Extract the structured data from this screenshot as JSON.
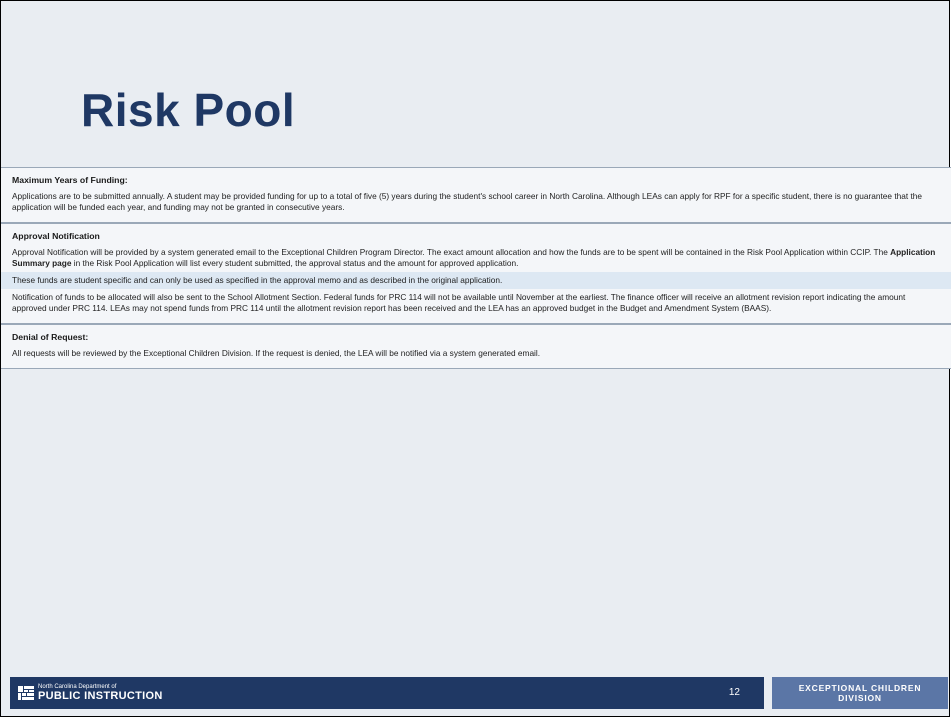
{
  "slide": {
    "title": "Risk Pool",
    "page_number": "12"
  },
  "sections": {
    "max_years_header": "Maximum Years of Funding:",
    "max_years_text": "Applications are to be submitted annually. A student may be provided funding for up to a total of five (5) years during the student's school career in North Carolina. Although LEAs can apply for RPF for a specific student, there is no guarantee that the application will be funded each year, and funding may not be granted in consecutive years.",
    "approval_header": "Approval Notification",
    "approval_text_1": "Approval Notification will be provided by a system generated email to the Exceptional Children Program Director. The exact amount allocation and how the funds are to be spent will be contained in the Risk Pool Application within CCIP. The",
    "approval_text_bold": "Application Summary page",
    "approval_text_2": "in the Risk Pool Application will list every student submitted, the approval status and the amount for approved application.",
    "funds_specific": "These funds are student specific and can only be used as specified in the approval memo and as described in the original application.",
    "notification_text": "Notification of funds to be allocated will also be sent to the School Allotment Section. Federal funds for PRC 114 will not be available until November at the earliest. The finance officer will receive an allotment revision report indicating the amount approved under PRC 114. LEAs may not spend funds from PRC 114 until the allotment revision report has been received and the LEA has an approved budget in the Budget and Amendment System (BAAS).",
    "denial_header": "Denial of Request:",
    "denial_text": "All requests will be reviewed by the Exceptional Children Division. If the request is denied, the LEA will be notified via a system generated email."
  },
  "footer": {
    "dept_line": "North Carolina Department of",
    "org_line": "PUBLIC INSTRUCTION",
    "division_line1": "EXCEPTIONAL CHILDREN",
    "division_line2": "DIVISION",
    "logo_icon": "ncdpi-logo-icon"
  }
}
